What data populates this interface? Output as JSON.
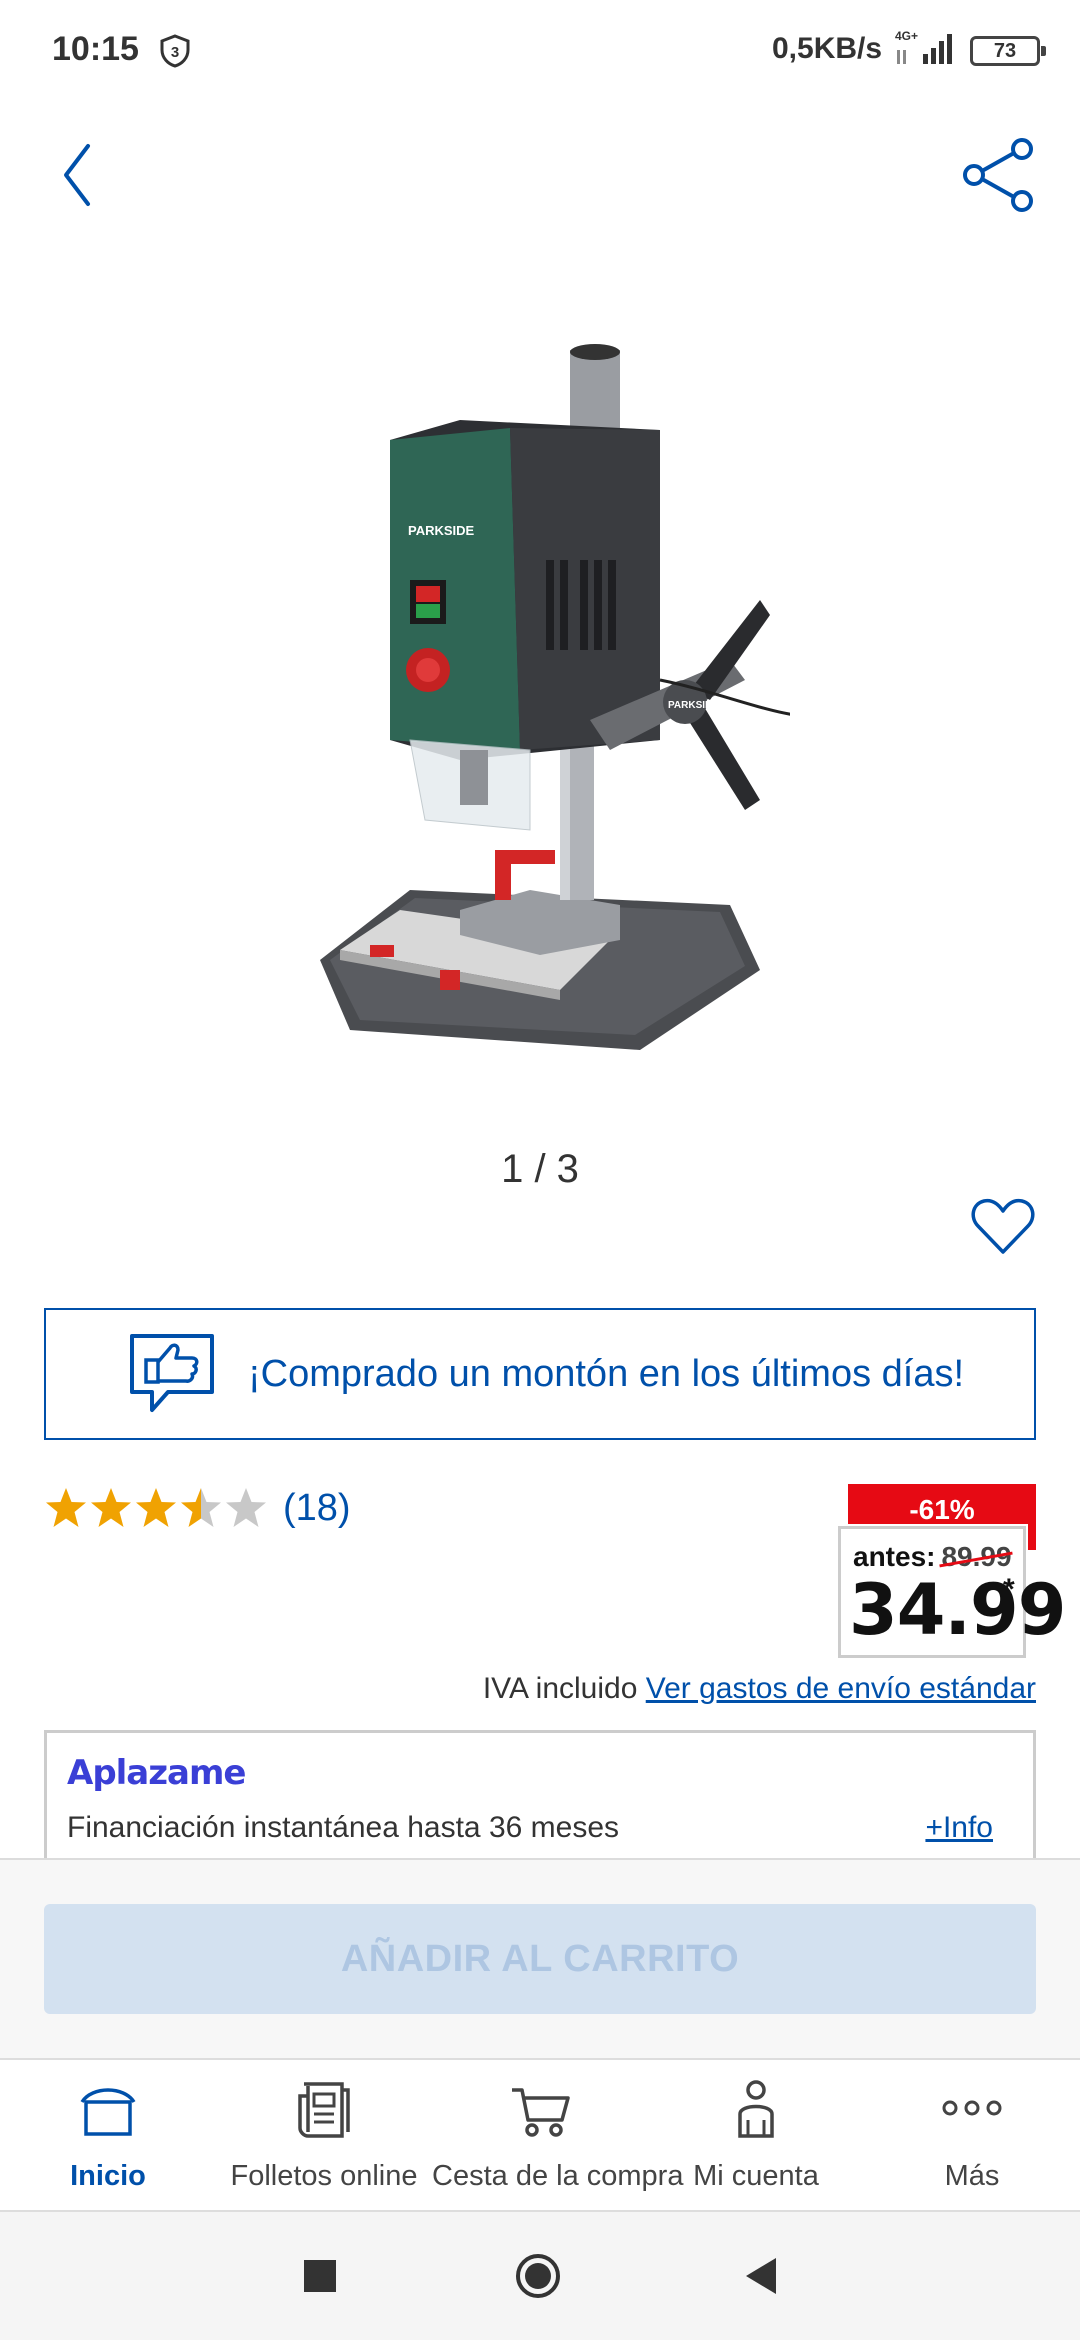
{
  "status_bar": {
    "time": "10:15",
    "notification_count": "3",
    "speed": "0,5KB/s",
    "network": "4G+",
    "battery": "73"
  },
  "product": {
    "image_label": "PARKSIDE",
    "pager": "1 / 3"
  },
  "popular_banner": {
    "text": "¡Comprado un montón en los últimos días!"
  },
  "rating": {
    "value": 3.5,
    "count_text": "(18)"
  },
  "price": {
    "discount": "-61%",
    "before_label": "antes:",
    "before_value": "89.99",
    "current": "34.99",
    "asterisk": "*"
  },
  "shipping": {
    "vat_text": "IVA incluido",
    "link_text": "Ver gastos de envío estándar"
  },
  "aplazame": {
    "logo": "Aplazame",
    "text": "Financiación instantánea hasta 36 meses",
    "info_link": "+Info"
  },
  "cart": {
    "button_label": "AÑADIR AL CARRITO"
  },
  "bottom_nav": {
    "items": [
      {
        "label": "Inicio",
        "icon": "home-icon",
        "active": true
      },
      {
        "label": "Folletos online",
        "icon": "flyer-icon",
        "active": false
      },
      {
        "label": "Cesta de la compra",
        "icon": "cart-icon",
        "active": false
      },
      {
        "label": "Mi cuenta",
        "icon": "user-icon",
        "active": false
      },
      {
        "label": "Más",
        "icon": "more-icon",
        "active": false
      }
    ]
  },
  "colors": {
    "brand_blue": "#0050aa",
    "discount_red": "#e60a14",
    "star_gold": "#f0a202",
    "star_grey": "#c8c8c8",
    "cart_disabled_bg": "#d3e1f0",
    "aplazame_purple": "#3a3fd6"
  }
}
